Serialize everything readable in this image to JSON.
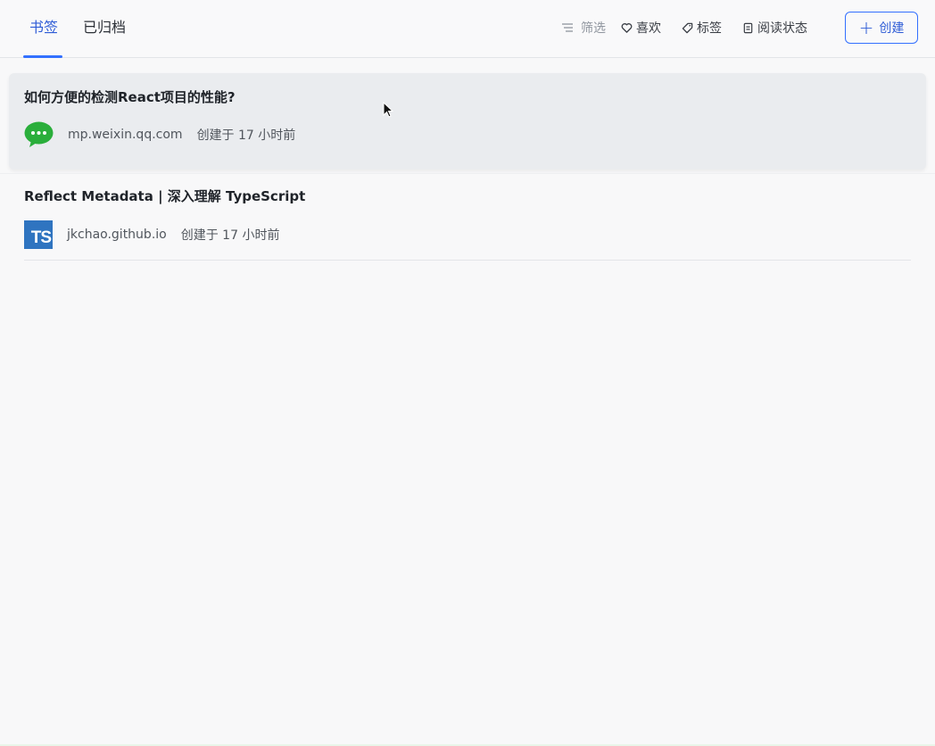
{
  "tabs": [
    {
      "label": "书签",
      "active": true
    },
    {
      "label": "已归档",
      "active": false
    }
  ],
  "toolbar": {
    "filter": "筛选",
    "like": "喜欢",
    "tag": "标签",
    "read_status": "阅读状态",
    "create": "创建"
  },
  "bookmarks": [
    {
      "title": "如何方便的检测React项目的性能?",
      "icon": "wechat-icon",
      "domain": "mp.weixin.qq.com",
      "created": "创建于 17 小时前"
    },
    {
      "title": "Reflect Metadata | 深入理解 TypeScript",
      "icon": "typescript-icon",
      "icon_text": "TS",
      "domain": "jkchao.github.io",
      "created": "创建于 17 小时前"
    }
  ],
  "colors": {
    "accent": "#3370ff",
    "wechat": "#2aae3b",
    "typescript": "#2f74c0"
  }
}
